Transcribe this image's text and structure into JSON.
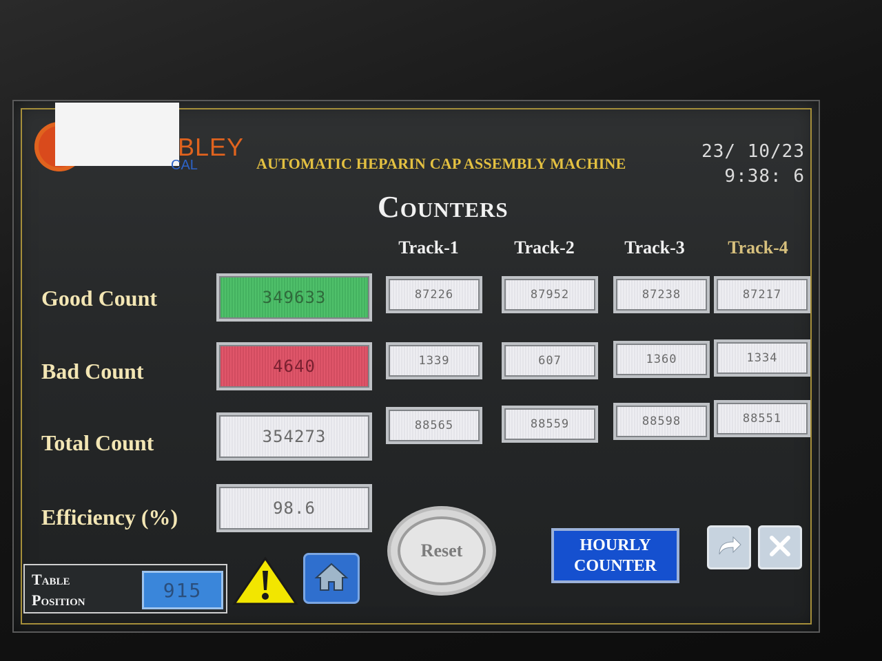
{
  "header": {
    "logo_text": "BLEY",
    "logo_sub": "CAL",
    "machine_title": "AUTOMATIC HEPARIN CAP ASSEMBLY MACHINE",
    "date": "23/ 10/23",
    "time": "9:38: 6",
    "page_title": "Counters"
  },
  "columns": [
    "Track-1",
    "Track-2",
    "Track-3",
    "Track-4"
  ],
  "rows": [
    {
      "label": "Good Count",
      "total": "349633",
      "tracks": [
        "87226",
        "87952",
        "87238",
        "87217"
      ]
    },
    {
      "label": "Bad Count",
      "total": "4640",
      "tracks": [
        "1339",
        "607",
        "1360",
        "1334"
      ]
    },
    {
      "label": "Total Count",
      "total": "354273",
      "tracks": [
        "88565",
        "88559",
        "88598",
        "88551"
      ]
    },
    {
      "label": "Efficiency (%)",
      "total": "98.6"
    }
  ],
  "buttons": {
    "reset": "Reset",
    "hourly_counter": [
      "HOURLY",
      "COUNTER"
    ]
  },
  "table_position": {
    "label_line1": "Table",
    "label_line2": "Position",
    "value": "915"
  },
  "colors": {
    "accent_gold": "#e3c041",
    "good_green": "#4fc06a",
    "bad_red": "#e0566a",
    "button_blue": "#1550cf"
  },
  "icons": [
    "warning-icon",
    "home-icon",
    "forward-arrow-icon",
    "close-icon"
  ]
}
